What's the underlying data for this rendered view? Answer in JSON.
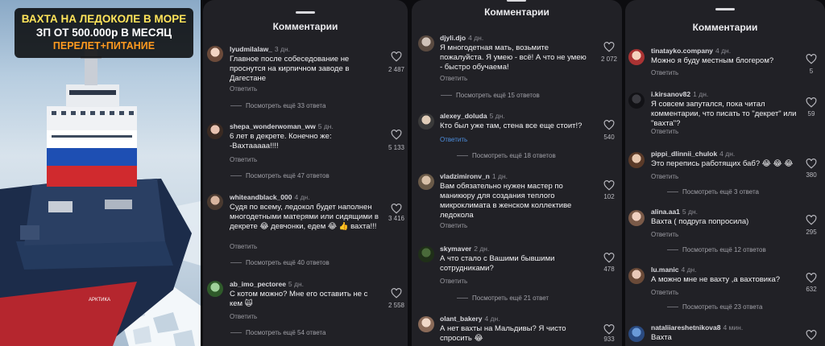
{
  "hero": {
    "line1": "ВАХТА НА ЛЕДОКОЛЕ В МОРЕ",
    "line2": "ЗП ОТ 500.000р  В МЕСЯЦ",
    "line3": "ПЕРЕЛЕТ+ПИТАНИЕ",
    "ship_name": "АРКТИКА"
  },
  "panels": [
    {
      "title": "Комментарии",
      "comments": [
        {
          "user": "lyudmilalaw_",
          "ago": "3 дн.",
          "text": "Главное после собеседование не проснутся на кирпичном заводе в Дагестане",
          "reply": "Ответить",
          "likes": "2 487",
          "more": "Посмотреть ещё 33 ответа"
        },
        {
          "user": "shepa_wonderwoman_ww",
          "ago": "5 дн.",
          "text": "6 лет в декрете. Конечно же: -Вахтааааа!!!!",
          "reply": "Ответить",
          "likes": "5 133",
          "more": "Посмотреть ещё 47 ответов"
        },
        {
          "user": "whiteandblack_000",
          "ago": "4 дн.",
          "text": "Судя по всему, ледокол будет наполнен многодетными матерями или сидящими в декрете 😂 девчонки, едем 😂 👍 вахта!!!",
          "reply": "Ответить",
          "likes": "3 416",
          "more": "Посмотреть ещё 40 ответов"
        },
        {
          "user": "ab_imo_pectoree",
          "ago": "5 дн.",
          "text": "С котом можно? Мне его оставить не с кем 🙀",
          "reply": "Ответить",
          "likes": "2 558",
          "more": "Посмотреть ещё 54 ответа"
        }
      ]
    },
    {
      "title": "Комментарии",
      "comments": [
        {
          "user": "djyli.djo",
          "ago": "4 дн.",
          "text": "Я многодетная мать, возьмите пожалуйста. Я умею - всё! А что не умею - быстро обучаема!",
          "reply": "Ответить",
          "likes": "2 072",
          "more": "Посмотреть ещё 15 ответов"
        },
        {
          "user": "alexey_doluda",
          "ago": "5 дн.",
          "text": "Кто был уже там, стена все еще стоит!?",
          "reply": "Ответить",
          "likes": "540",
          "more": "Посмотреть ещё 18 ответов"
        },
        {
          "user": "vladzimironv_n",
          "ago": "1 дн.",
          "text": "Вам обязательно нужен мастер по маникюру для создания теплого микроклимата в женском коллективе ледокола",
          "reply": "Ответить",
          "likes": "102",
          "more": ""
        },
        {
          "user": "skymaver",
          "ago": "2 дн.",
          "text": "А что стало с Вашими бывшими сотрудниками?",
          "reply": "Ответить",
          "likes": "478",
          "more": "Посмотреть ещё 21 ответ"
        },
        {
          "user": "olant_bakery",
          "ago": "4 дн.",
          "text": "А нет вахты на Мальдивы? Я чисто спросить 😂",
          "reply": "",
          "likes": "933",
          "more": ""
        }
      ]
    },
    {
      "title": "Комментарии",
      "comments": [
        {
          "user": "tinatayko.company",
          "ago": "4 дн.",
          "text": "Можно я буду местным блогером?",
          "reply": "Ответить",
          "likes": "5",
          "more": ""
        },
        {
          "user": "i.kirsanov82",
          "ago": "1 дн.",
          "text": "Я совсем запутался, пока читал комментарии, что писать то \"декрет\" или \"вахта\"?",
          "reply": "Ответить",
          "likes": "59",
          "more": ""
        },
        {
          "user": "pippi_dlinnii_chulok",
          "ago": "4 дн.",
          "text": "Это перепись работящих баб? 😂 😂 😂",
          "reply": "Ответить",
          "likes": "380",
          "more": "Посмотреть ещё 3 ответа"
        },
        {
          "user": "alina.aa1",
          "ago": "5 дн.",
          "text": "Вахта ( подруга попросила)",
          "reply": "Ответить",
          "likes": "295",
          "more": "Посмотреть ещё 12 ответов"
        },
        {
          "user": "lu.manic",
          "ago": "4 дн.",
          "text": "А можно мне не вахту ,а вахтовика?",
          "reply": "Ответить",
          "likes": "632",
          "more": "Посмотреть ещё 23 ответа"
        },
        {
          "user": "nataliiareshetnikova8",
          "ago": "4 мин.",
          "text": "Вахта",
          "reply": "",
          "likes": "",
          "more": ""
        }
      ]
    }
  ],
  "colors": {
    "panel_bg": "#212126",
    "reply_link_blue": "#4d8fe0",
    "caption_yellow": "#ffe45a",
    "caption_orange": "#ff9a1f"
  }
}
